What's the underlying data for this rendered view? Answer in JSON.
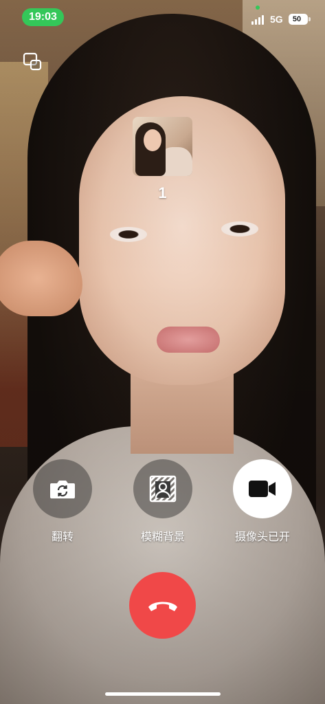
{
  "status_bar": {
    "time": "19:03",
    "network": "5G",
    "battery": "50",
    "accent_color": "#34c759"
  },
  "call": {
    "caller_name": "1",
    "minimize_icon": "picture-in-picture-icon"
  },
  "controls": {
    "flip": {
      "label": "翻转",
      "icon": "camera-flip-icon"
    },
    "blur": {
      "label": "模糊背景",
      "icon": "blur-background-icon"
    },
    "camera": {
      "label": "摄像头已开",
      "icon": "video-camera-icon",
      "state": "on"
    },
    "hangup": {
      "icon": "hang-up-icon",
      "color": "#f04848"
    }
  }
}
